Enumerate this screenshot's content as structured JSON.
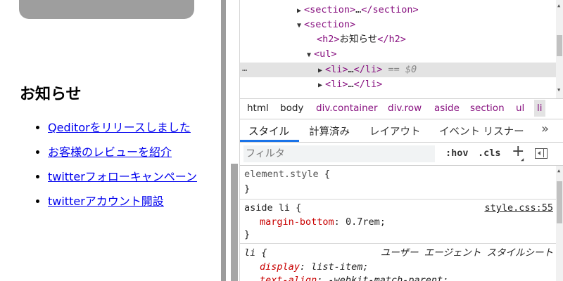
{
  "page": {
    "heading": "お知らせ",
    "news_items": [
      "Qeditorをリリースしました",
      "お客様のレビューを紹介",
      "twitterフォローキャンペーン",
      "twitterアカウント開設"
    ]
  },
  "elements_tree": {
    "row_section_collapsed": {
      "open": "<section>",
      "ellipsis": "…",
      "close": "</section>"
    },
    "row_section_open": "<section>",
    "row_h2": {
      "open": "<h2>",
      "text": "お知らせ",
      "close": "</h2>"
    },
    "row_ul": "<ul>",
    "row_li_selected": {
      "open": "<li>",
      "ellipsis": "…",
      "close": "</li>",
      "marker": "== $0"
    },
    "row_li_2": {
      "open": "<li>",
      "ellipsis": "…",
      "close": "</li>"
    },
    "dots": "…"
  },
  "breadcrumb": [
    "html",
    "body",
    "div.container",
    "div.row",
    "aside",
    "section",
    "ul",
    "li"
  ],
  "tabs": [
    "スタイル",
    "計算済み",
    "レイアウト",
    "イベント リスナー"
  ],
  "tab_more": "»",
  "filter": {
    "placeholder": "フィルタ",
    "hov": ":hov",
    "cls": ".cls",
    "plus": "+"
  },
  "styles": {
    "element_style": {
      "selector": "element.style",
      "open": "{",
      "close": "}"
    },
    "aside_li": {
      "selector": "aside li",
      "open": "{",
      "close": "}",
      "source": "style.css:55",
      "prop_name": "margin-bottom",
      "prop_value": "0.7rem;"
    },
    "li_ua": {
      "selector": "li",
      "open": "{",
      "source": "ユーザー エージェント スタイルシート",
      "props": [
        {
          "name": "display",
          "value": "list-item;"
        },
        {
          "name": "text-align",
          "value": "-webkit-match-parent;"
        }
      ]
    }
  },
  "colors": {
    "accent": "#1a73e8",
    "tag": "#881280",
    "prop_name": "#c80000",
    "link": "#0000ee"
  }
}
